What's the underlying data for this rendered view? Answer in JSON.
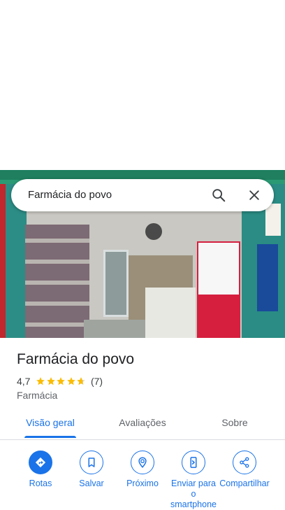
{
  "search": {
    "query": "Farmácia do povo",
    "search_icon": "search-icon",
    "close_icon": "close-icon"
  },
  "place": {
    "name": "Farmácia do povo",
    "rating": "4,7",
    "rating_value": 4.7,
    "rating_max": 5,
    "review_count": "(7)",
    "category": "Farmácia"
  },
  "tabs": [
    {
      "label": "Visão geral",
      "active": true
    },
    {
      "label": "Avaliações",
      "active": false
    },
    {
      "label": "Sobre",
      "active": false
    }
  ],
  "actions": [
    {
      "label": "Rotas",
      "icon": "directions-icon"
    },
    {
      "label": "Salvar",
      "icon": "bookmark-icon"
    },
    {
      "label": "Próximo",
      "icon": "nearby-icon"
    },
    {
      "label": "Enviar para o smartphone",
      "icon": "send-to-phone-icon"
    },
    {
      "label": "Compartilhar",
      "icon": "share-icon"
    }
  ],
  "colors": {
    "accent": "#1a73e8",
    "star": "#fbbc04",
    "text_primary": "#202124",
    "text_secondary": "#5f6368"
  }
}
